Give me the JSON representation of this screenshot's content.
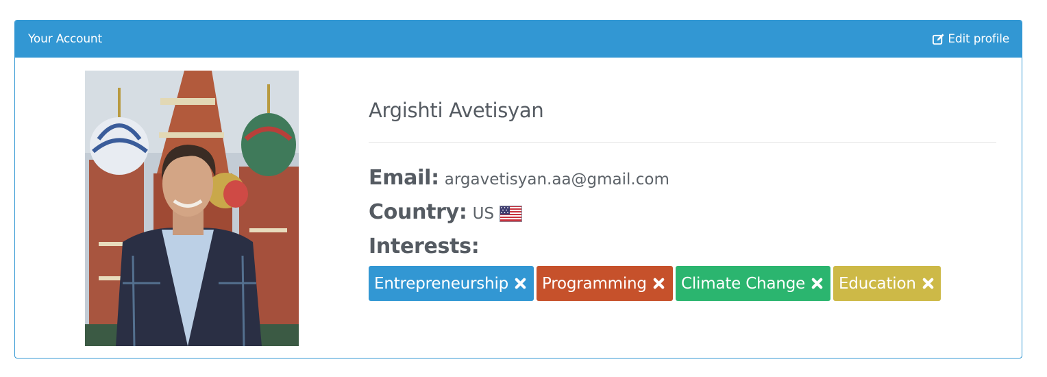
{
  "header": {
    "title": "Your Account",
    "edit_label": "Edit profile"
  },
  "profile": {
    "name": "Argishti Avetisyan",
    "email_label": "Email:",
    "email": "argavetisyan.aa@gmail.com",
    "country_label": "Country:",
    "country": "US",
    "interests_label": "Interests:",
    "interests": [
      "Entrepreneurship",
      "Programming",
      "Climate Change",
      "Education"
    ]
  },
  "colors": {
    "accent": "#3297d3",
    "tag_entrepreneurship": "#3297d3",
    "tag_programming": "#c6512b",
    "tag_climate": "#2bb56f",
    "tag_education": "#cdb947"
  },
  "icons": {
    "edit": "edit-icon",
    "remove": "close-icon",
    "flag": "us-flag-icon"
  }
}
